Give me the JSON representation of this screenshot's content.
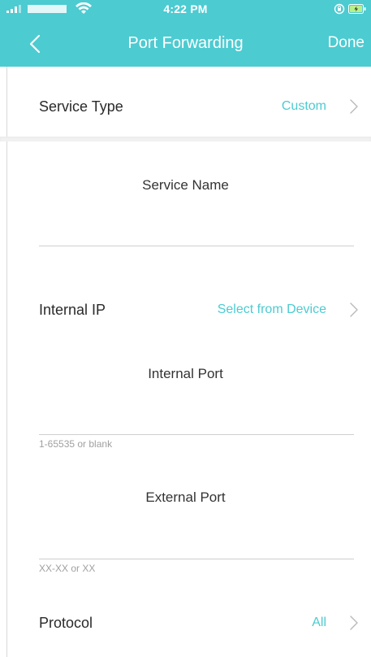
{
  "status_bar": {
    "time": "4:22 PM"
  },
  "header": {
    "title": "Port Forwarding",
    "done_label": "Done",
    "back_icon": "chevron-left-icon"
  },
  "service_type": {
    "label": "Service Type",
    "value": "Custom"
  },
  "service_name": {
    "title": "Service Name",
    "value": ""
  },
  "internal_ip": {
    "label": "Internal IP",
    "value": "Select from Device"
  },
  "internal_port": {
    "title": "Internal Port",
    "value": "",
    "hint": "1-65535 or blank"
  },
  "external_port": {
    "title": "External Port",
    "value": "",
    "hint": "XX-XX or XX"
  },
  "protocol": {
    "label": "Protocol",
    "value": "All"
  },
  "colors": {
    "accent": "#4ccbd1",
    "header_bg": "#4ccbd1",
    "text": "#2a2a2a",
    "hint": "#a0a0a0"
  }
}
